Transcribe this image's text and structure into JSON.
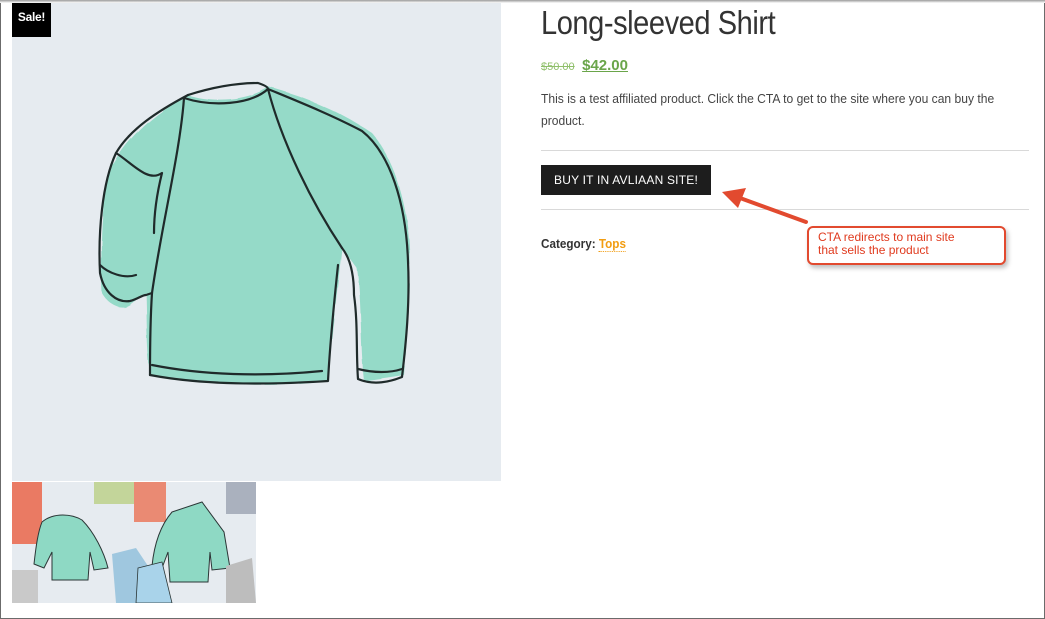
{
  "product": {
    "sale_badge": "Sale!",
    "title": "Long-sleeved Shirt",
    "old_price": "$50.00",
    "new_price": "$42.00",
    "description": "This is a test affiliated product. Click the CTA to get to the site where you can buy the product.",
    "cta_label": "BUY IT IN AVLIAAN SITE!",
    "category_label": "Category:",
    "category_value": "Tops"
  },
  "annotation": {
    "line1": "CTA redirects to main site",
    "line2": "that sells the product"
  },
  "colors": {
    "sale_badge_bg": "#000000",
    "price_green": "#6aa54a",
    "category_link": "#f29d12",
    "callout_red": "#e24a2f",
    "shirt_mint": "#8ed9c4"
  }
}
